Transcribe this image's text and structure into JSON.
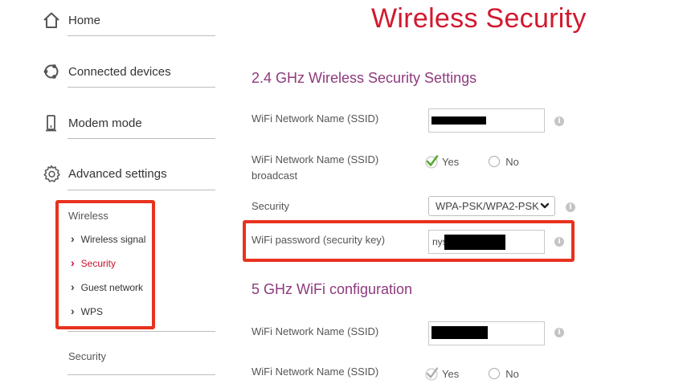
{
  "sidebar": {
    "nav": [
      {
        "label": "Home",
        "icon": "home-icon"
      },
      {
        "label": "Connected devices",
        "icon": "devices-icon"
      },
      {
        "label": "Modem mode",
        "icon": "modem-icon"
      },
      {
        "label": "Advanced settings",
        "icon": "gear-icon"
      }
    ],
    "wireless_header": "Wireless",
    "wireless_items": [
      {
        "label": "Wireless signal"
      },
      {
        "label": "Security",
        "active": true
      },
      {
        "label": "Guest network"
      },
      {
        "label": "WPS"
      }
    ],
    "security_header": "Security"
  },
  "main": {
    "title": "Wireless Security",
    "section_24": {
      "title": "2.4 GHz Wireless Security Settings",
      "ssid_label": "WiFi Network Name (SSID)",
      "broadcast_label": "WiFi Network Name (SSID) broadcast",
      "broadcast_yes": "Yes",
      "broadcast_no": "No",
      "security_label": "Security",
      "security_value": "WPA-PSK/WPA2-PSK",
      "password_label": "WiFi password (security key)",
      "password_prefix": "nys"
    },
    "section_5": {
      "title": "5 GHz WiFi configuration",
      "ssid_label": "WiFi Network Name (SSID)",
      "broadcast_label": "WiFi Network Name (SSID)",
      "broadcast_yes": "Yes",
      "broadcast_no": "No"
    },
    "info_glyph": "i"
  },
  "colors": {
    "title_red": "#d1192e",
    "section_purple": "#8e3a7d",
    "highlight_red": "#e8321f",
    "check_green": "#5aa832"
  }
}
